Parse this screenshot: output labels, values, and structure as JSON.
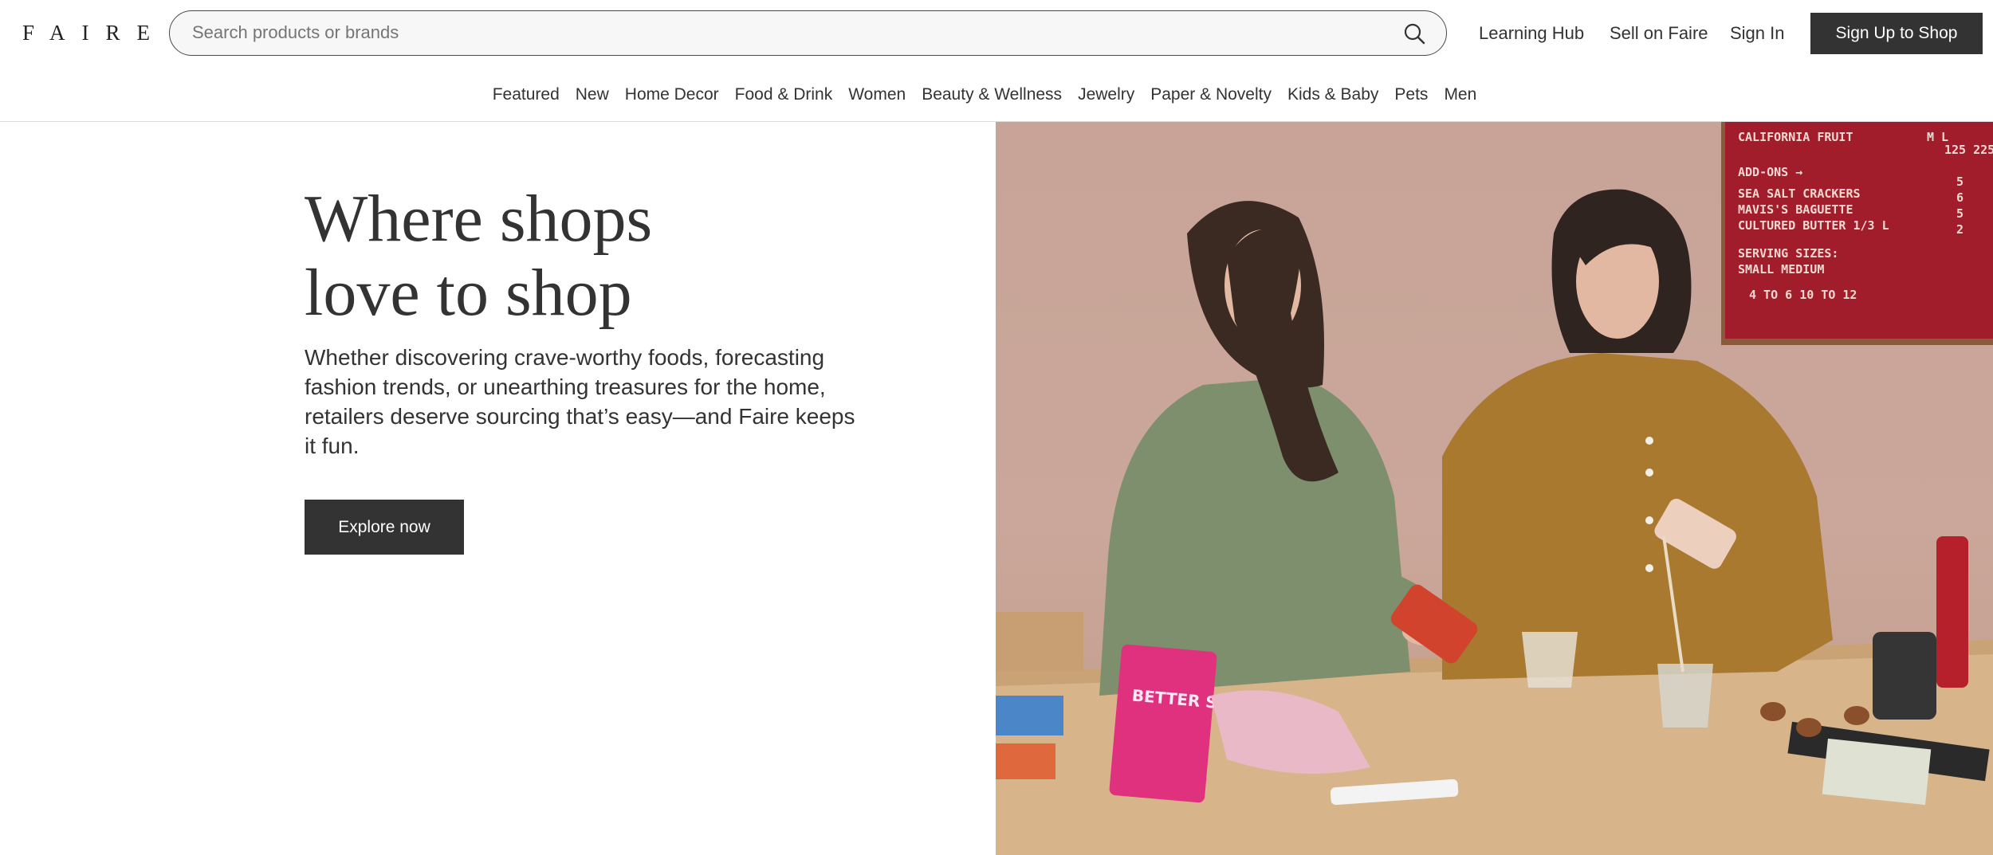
{
  "header": {
    "logo": "FAIRE",
    "search": {
      "placeholder": "Search products or brands",
      "icon": "search-icon"
    },
    "links": {
      "learning_hub": "Learning Hub",
      "sell_on_faire": "Sell on Faire",
      "sign_in": "Sign In"
    },
    "signup_label": "Sign Up to Shop"
  },
  "categories": [
    "Featured",
    "New",
    "Home Decor",
    "Food & Drink",
    "Women",
    "Beauty & Wellness",
    "Jewelry",
    "Paper & Novelty",
    "Kids & Baby",
    "Pets",
    "Men"
  ],
  "hero": {
    "title_line1": "Where shops",
    "title_line2": "love to shop",
    "description": "Whether discovering crave-worthy foods, forecasting fashion trends, or unearthing treasures for the home, retailers deserve sourcing that’s easy—and Faire keeps it fun.",
    "cta_label": "Explore now"
  },
  "photo": {
    "menu_board": {
      "title": "CALIFORNIA FRUIT",
      "sizes": "M  L",
      "prices_top": "125  225",
      "add_ons": "ADD-ONS →",
      "items": [
        "SEA SALT CRACKERS",
        "MAVIS'S BAGUETTE",
        "CULTURED BUTTER  1/3 L"
      ],
      "item_prices": [
        "5",
        "6",
        "5",
        "2"
      ],
      "serving_sizes": "SERVING  SIZES:",
      "small_medium": "SMALL        MEDIUM",
      "ranges": "4 TO 6        10 TO 12"
    },
    "package_text": "BETTER SOUR"
  },
  "colors": {
    "dark_button": "#333333",
    "text": "#333333",
    "wall": "#c7a497",
    "table": "#d9b48c",
    "menu_board": "#a11d2b"
  }
}
